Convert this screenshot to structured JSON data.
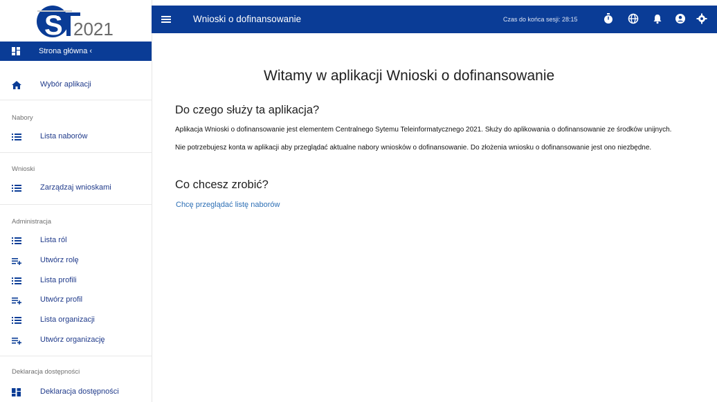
{
  "logo": {
    "text": "ST2021"
  },
  "sidebar": {
    "home_label": "Strona główna",
    "home_chevron": "‹",
    "items": [
      {
        "id": "wybor",
        "label": "Wybór aplikacji",
        "icon": "home-icon"
      },
      {
        "id": "lista-naborow",
        "label": "Lista naborów",
        "icon": "list-icon"
      },
      {
        "id": "zarzadzaj",
        "label": "Zarządzaj wnioskami",
        "icon": "list-icon"
      },
      {
        "id": "lista-rol",
        "label": "Lista ról",
        "icon": "list-icon"
      },
      {
        "id": "utworz-role",
        "label": "Utwórz rolę",
        "icon": "playlist-add-icon"
      },
      {
        "id": "lista-profili",
        "label": "Lista profili",
        "icon": "list-icon"
      },
      {
        "id": "utworz-profil",
        "label": "Utwórz profil",
        "icon": "playlist-add-icon"
      },
      {
        "id": "lista-organizacji",
        "label": "Lista organizacji",
        "icon": "list-icon"
      },
      {
        "id": "utworz-organizacje",
        "label": "Utwórz organizację",
        "icon": "playlist-add-icon"
      },
      {
        "id": "deklaracja",
        "label": "Deklaracja dostępności",
        "icon": "dashboard-icon"
      }
    ],
    "sections": {
      "nabory": "Nabory",
      "wnioski": "Wnioski",
      "administracja": "Administracja",
      "deklaracja": "Deklaracja dostępności"
    }
  },
  "header": {
    "title": "Wnioski o dofinansowanie",
    "session_text": "Czas do końca sesji: 28:15",
    "icons": [
      "timer-icon",
      "globe-icon",
      "bell-icon",
      "account-icon",
      "settings-icon"
    ]
  },
  "main": {
    "title": "Witamy w aplikacji Wnioski o dofinansowanie",
    "section1_title": "Do czego służy ta aplikacja?",
    "para1": "Aplikacja Wnioski o dofinansowanie jest elementem Centralnego Sytemu Teleinformatycznego 2021. Służy do aplikowania o dofinansowanie ze środków unijnych.",
    "para2": "Nie potrzebujesz konta w aplikacji aby przeglądać aktualne nabory wniosków o dofinansowanie. Do złożenia wniosku o dofinansowanie jest ono niezbędne.",
    "section2_title": "Co chcesz zrobić?",
    "link_text": "Chcę przeglądać listę naborów"
  },
  "colors": {
    "primary": "#0a3c96",
    "link": "#2d6fb5",
    "nav_text": "#1f3a8a",
    "section_text": "#6f6f6f"
  }
}
